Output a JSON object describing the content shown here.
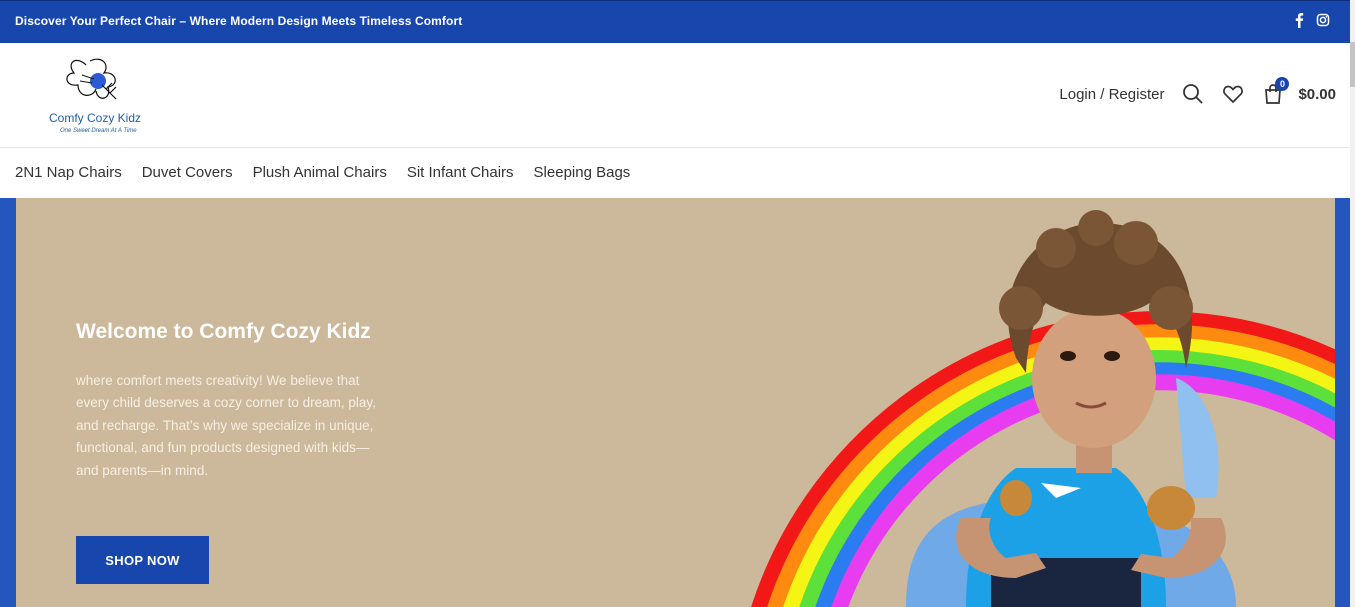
{
  "topbar": {
    "promo": "Discover Your Perfect Chair – Where Modern Design Meets Timeless Comfort",
    "social_icons": [
      "facebook-icon",
      "instagram-icon"
    ]
  },
  "logo": {
    "brand": "Comfy Cozy Kidz",
    "tagline": "One Sweet Dream At A Time"
  },
  "header": {
    "login_label": "Login / Register",
    "icons": [
      "search-icon",
      "heart-icon",
      "cart-icon"
    ],
    "cart_count": "0",
    "cart_total": "$0.00"
  },
  "nav": {
    "items": [
      {
        "label": "2N1 Nap Chairs"
      },
      {
        "label": "Duvet Covers"
      },
      {
        "label": "Plush Animal Chairs"
      },
      {
        "label": "Sit Infant Chairs"
      },
      {
        "label": "Sleeping Bags"
      }
    ]
  },
  "hero": {
    "title": "Welcome to Comfy Cozy Kidz",
    "body": "where comfort meets creativity! We believe that every child deserves a cozy corner to dream, play, and recharge. That’s why we specialize in unique, functional, and fun products designed with kids—and parents—in mind.",
    "cta": "SHOP NOW"
  },
  "colors": {
    "brand_blue": "#1746ad",
    "hero_bg": "#ccb89a",
    "rainbow": [
      "#f21818",
      "#ff8a10",
      "#f5f515",
      "#5ee03a",
      "#2b7cf0",
      "#e83cf0"
    ]
  }
}
